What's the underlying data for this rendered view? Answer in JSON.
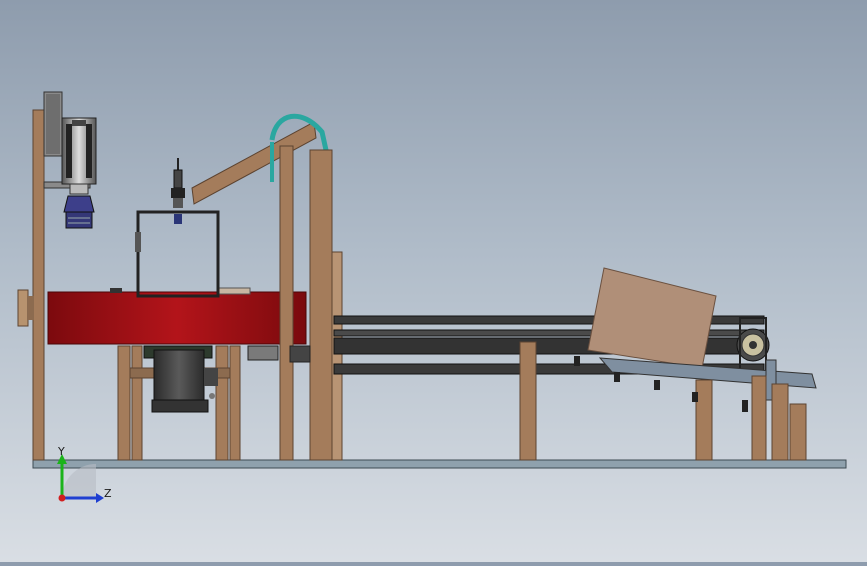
{
  "view": {
    "orientation_triad": {
      "vertical_axis_label": "Y",
      "horizontal_axis_label": "Z",
      "vertical_axis_color": "#1bb31b",
      "horizontal_axis_color": "#1f3fd1",
      "origin_color": "#d11f1f"
    }
  },
  "colors": {
    "background_top": "#8e9cad",
    "background_bottom": "#d9dee4",
    "wood_frame": "#a47c5b",
    "wood_frame_dark": "#7a5a40",
    "red_drum": "#a30f14",
    "steel_dark": "#3a3a3a",
    "steel_mid": "#6e6e6e",
    "hose": "#2aa7a0",
    "base_plate": "#8fa1ad",
    "panel": "#b08f78"
  },
  "icons": {
    "motor": "motor-icon",
    "nozzle": "nozzle-icon",
    "pulley": "pulley-icon"
  }
}
